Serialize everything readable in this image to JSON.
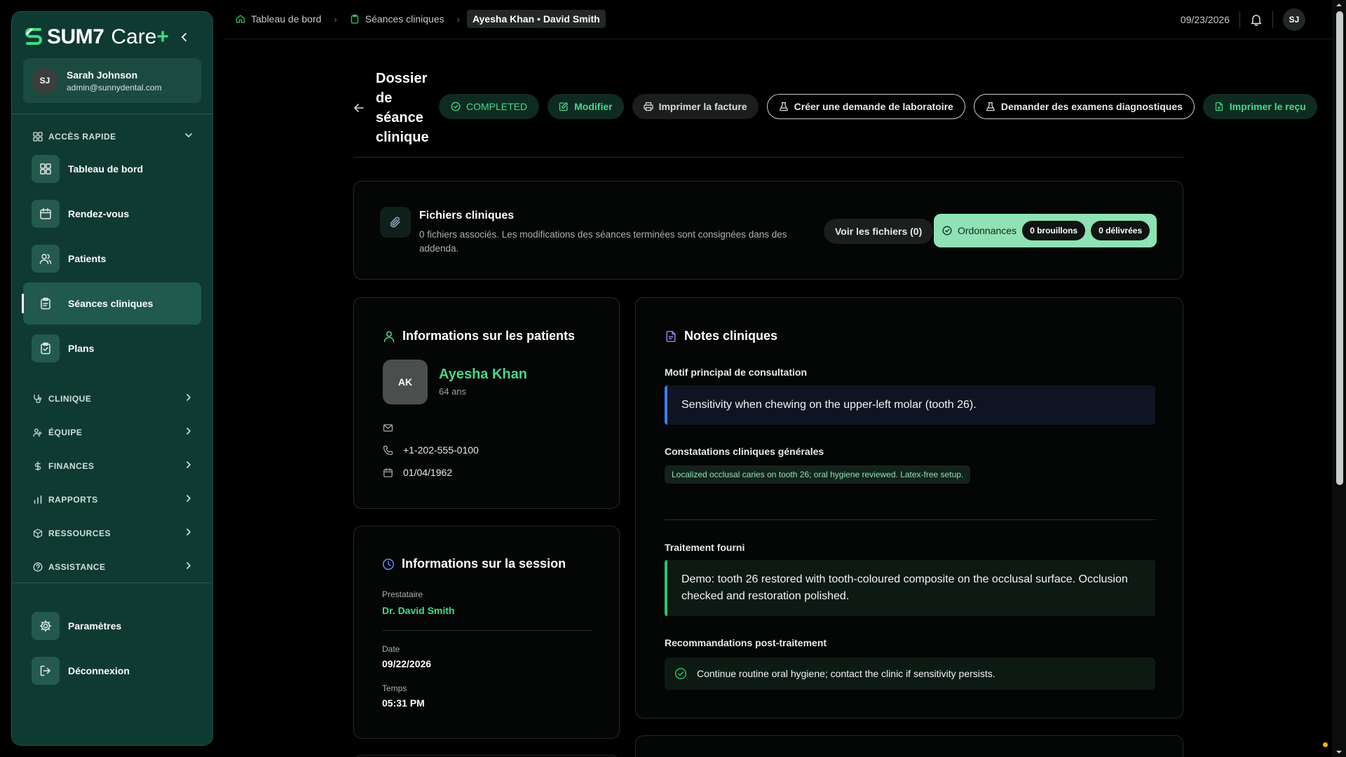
{
  "brand": {
    "name": "SUM7",
    "product": "Care",
    "plus": "+"
  },
  "user": {
    "initials": "SJ",
    "name": "Sarah Johnson",
    "email": "admin@sunnydental.com"
  },
  "sidebar": {
    "quick_access_label": "ACCÈS RAPIDE",
    "quick_items": [
      {
        "label": "Tableau de bord",
        "icon": "dashboard-icon"
      },
      {
        "label": "Rendez-vous",
        "icon": "calendar-icon"
      },
      {
        "label": "Patients",
        "icon": "users-icon"
      },
      {
        "label": "Séances cliniques",
        "icon": "clipboard-icon",
        "active": true
      },
      {
        "label": "Plans",
        "icon": "clipboard-check-icon"
      }
    ],
    "sections": [
      {
        "label": "CLINIQUE",
        "icon": "stethoscope-icon"
      },
      {
        "label": "ÉQUIPE",
        "icon": "team-icon"
      },
      {
        "label": "FINANCES",
        "icon": "dollar-icon"
      },
      {
        "label": "RAPPORTS",
        "icon": "bar-chart-icon"
      },
      {
        "label": "RESSOURCES",
        "icon": "package-icon"
      },
      {
        "label": "ASSISTANCE",
        "icon": "help-icon"
      }
    ],
    "bottom_items": [
      {
        "label": "Paramètres",
        "icon": "gear-icon"
      },
      {
        "label": "Déconnexion",
        "icon": "logout-icon"
      }
    ]
  },
  "topbar": {
    "breadcrumbs": [
      {
        "label": "Tableau de bord"
      },
      {
        "label": "Séances cliniques"
      },
      {
        "label": "Ayesha Khan • David Smith"
      }
    ],
    "date": "09/23/2026",
    "avatar_initials": "SJ"
  },
  "page": {
    "title": "Dossier de séance clinique",
    "status": "COMPLETED",
    "actions": {
      "edit": "Modifier",
      "print_invoice": "Imprimer la facture",
      "lab_request": "Créer une demande de laboratoire",
      "diagnostics": "Demander des examens diagnostiques",
      "print_receipt": "Imprimer le reçu"
    }
  },
  "files": {
    "title": "Fichiers cliniques",
    "description": "0 fichiers associés. Les modifications des séances terminées sont consignées dans des addenda.",
    "view_button": "Voir les fichiers (0)",
    "prescriptions_label": "Ordonnances",
    "drafts": "0 brouillons",
    "delivered": "0 délivrées"
  },
  "patient": {
    "section_title": "Informations sur les patients",
    "initials": "AK",
    "name": "Ayesha Khan",
    "age": "64 ans",
    "email": "",
    "phone": "+1-202-555-0100",
    "dob": "01/04/1962"
  },
  "session": {
    "section_title": "Informations sur la session",
    "provider_label": "Prestataire",
    "provider": "Dr. David Smith",
    "date_label": "Date",
    "date": "09/22/2026",
    "time_label": "Temps",
    "time": "05:31 PM"
  },
  "notes": {
    "section_title": "Notes cliniques",
    "chief_complaint_label": "Motif principal de consultation",
    "chief_complaint": "Sensitivity when chewing on the upper-left molar (tooth 26).",
    "findings_label": "Constatations cliniques générales",
    "findings": "Localized occlusal caries on tooth 26; oral hygiene reviewed. Latex-free setup.",
    "treatment_label": "Traitement fourni",
    "treatment": "Demo: tooth 26 restored with tooth-coloured composite on the occlusal surface. Occlusion checked and restoration polished.",
    "recommendations_label": "Recommandations post-traitement",
    "recommendation": "Continue routine oral hygiene; contact the clinic if sensitivity persists."
  },
  "colors": {
    "sidebar_bg": "#0f3a32",
    "accent_green": "#48d889",
    "prescriptions_bg": "#8ee2b4",
    "complaint_border": "#3d7dff",
    "treatment_border": "#2fc46c"
  }
}
